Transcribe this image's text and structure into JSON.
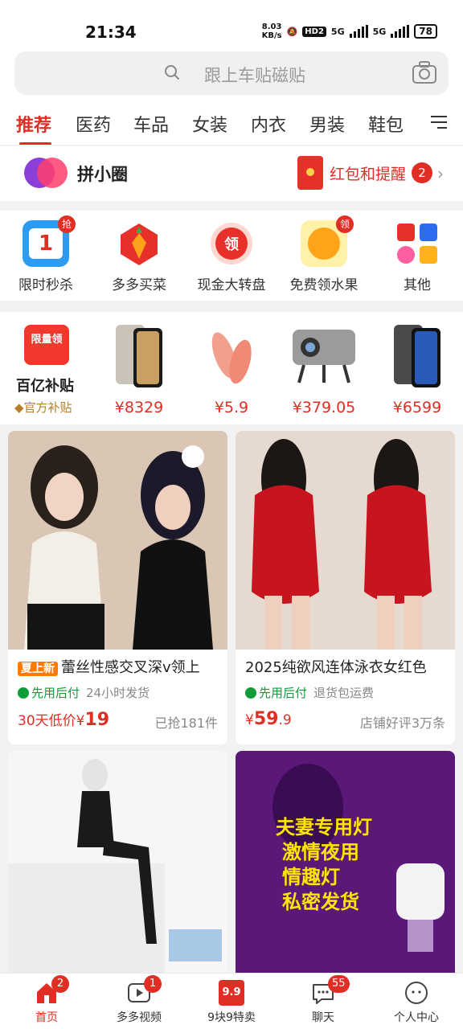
{
  "status": {
    "time": "21:34",
    "net_speed_top": "8.03",
    "net_speed_bottom": "KB/s",
    "hd": "HD2",
    "sig1": "5G",
    "sig2": "5G",
    "battery": "78"
  },
  "search": {
    "placeholder": "跟上车贴磁贴"
  },
  "categories": [
    "推荐",
    "医药",
    "车品",
    "女装",
    "内衣",
    "男装",
    "鞋包"
  ],
  "pinxiaoquan": {
    "title": "拼小圈",
    "redpacket_label": "红包和提醒",
    "redpacket_count": "2"
  },
  "quick": [
    {
      "label": "限时秒杀",
      "badge": "抢"
    },
    {
      "label": "多多买菜",
      "badge": ""
    },
    {
      "label": "现金大转盘",
      "badge": ""
    },
    {
      "label": "免费领水果",
      "badge": "领"
    },
    {
      "label": "其他",
      "badge": ""
    }
  ],
  "subsidy": {
    "icon_text": "限量领",
    "title": "百亿补贴",
    "subtitle": "官方补贴",
    "products": [
      {
        "price": "¥8329"
      },
      {
        "price": "¥5.9"
      },
      {
        "price": "¥379.05"
      },
      {
        "price": "¥6599"
      }
    ]
  },
  "feed": [
    {
      "tag": "夏上新",
      "title": "蕾丝性感交叉深v领上",
      "pay": "先用后付",
      "ship": "24小时发货",
      "price_prefix": "30天低价¥",
      "price": "19",
      "sold": "已抢181件"
    },
    {
      "tag": "",
      "title": "2025纯欲风连体泳衣女红色",
      "pay": "先用后付",
      "ship": "退货包运费",
      "price_prefix": "¥",
      "price": "59",
      "price_dec": ".9",
      "sold": "店铺好评3万条"
    },
    {
      "title": ""
    },
    {
      "poster_lines": [
        "夫妻专用灯",
        "激情夜用",
        "情趣灯",
        "私密发货"
      ]
    }
  ],
  "tabbar": [
    {
      "label": "首页",
      "badge": "2"
    },
    {
      "label": "多多视频",
      "badge": "1"
    },
    {
      "label": "9块9特卖",
      "badge": "",
      "icon_text": "9.9"
    },
    {
      "label": "聊天",
      "badge": "55"
    },
    {
      "label": "个人中心",
      "badge": ""
    }
  ],
  "colors": {
    "brand": "#e02e24",
    "green": "#0f9d3a",
    "gold": "#b5802a"
  }
}
